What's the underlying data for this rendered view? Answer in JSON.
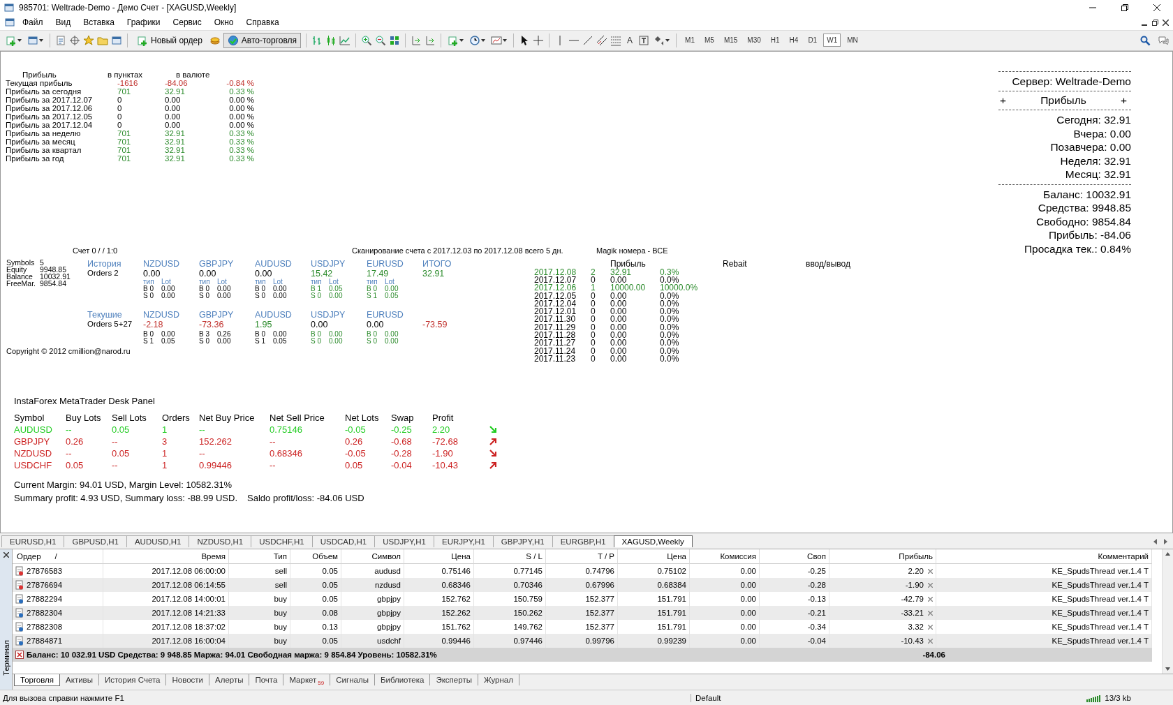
{
  "window": {
    "title": "985701: Weltrade-Demo - Демо Счет - [XAGUSD,Weekly]"
  },
  "menu": [
    "Файл",
    "Вид",
    "Вставка",
    "Графики",
    "Сервис",
    "Окно",
    "Справка"
  ],
  "toolbar": {
    "new_order": "Новый ордер",
    "autotrading": "Авто-торговля",
    "text_tool": "A",
    "timeframes": [
      {
        "label": "M1",
        "selected": false
      },
      {
        "label": "M5",
        "selected": false
      },
      {
        "label": "M15",
        "selected": false
      },
      {
        "label": "M30",
        "selected": false
      },
      {
        "label": "H1",
        "selected": false
      },
      {
        "label": "H4",
        "selected": false
      },
      {
        "label": "D1",
        "selected": false
      },
      {
        "label": "W1",
        "selected": true
      },
      {
        "label": "MN",
        "selected": false
      }
    ]
  },
  "profit_table": {
    "headers": [
      "Прибыль",
      "в пунктах",
      "в валюте"
    ],
    "rows": [
      {
        "label": "Текущая прибыль",
        "points": "-1616",
        "money": "-84.06",
        "percent": "-0.84 %",
        "kind": "loss"
      },
      {
        "label": "Прибыль за сегодня",
        "points": "701",
        "money": "32.91",
        "percent": "0.33 %",
        "kind": "gain"
      },
      {
        "label": "Прибыль за 2017.12.07",
        "points": "0",
        "money": "0.00",
        "percent": "0.00 %",
        "kind": "neutral"
      },
      {
        "label": "Прибыль за 2017.12.06",
        "points": "0",
        "money": "0.00",
        "percent": "0.00 %",
        "kind": "neutral"
      },
      {
        "label": "Прибыль за 2017.12.05",
        "points": "0",
        "money": "0.00",
        "percent": "0.00 %",
        "kind": "neutral"
      },
      {
        "label": "Прибыль за 2017.12.04",
        "points": "0",
        "money": "0.00",
        "percent": "0.00 %",
        "kind": "neutral"
      },
      {
        "label": "Прибыль за неделю",
        "points": "701",
        "money": "32.91",
        "percent": "0.33 %",
        "kind": "gain"
      },
      {
        "label": "Прибыль за месяц",
        "points": "701",
        "money": "32.91",
        "percent": "0.33 %",
        "kind": "gain"
      },
      {
        "label": "Прибыль за квартал",
        "points": "701",
        "money": "32.91",
        "percent": "0.33 %",
        "kind": "gain"
      },
      {
        "label": "Прибыль за год",
        "points": "701",
        "money": "32.91",
        "percent": "0.33 %",
        "kind": "gain"
      }
    ]
  },
  "server_panel": {
    "server": "Сервер: Weltrade-Demo",
    "header": {
      "left": "+",
      "title": "Прибыль",
      "right": "+"
    },
    "profits": [
      "Сегодня: 32.91",
      "Вчера: 0.00",
      "Позавчера: 0.00",
      "Неделя: 32.91",
      "Месяц: 32.91"
    ],
    "account": [
      "Баланс: 10032.91",
      "Средства: 9948.85",
      "Свободно: 9854.84",
      "Прибыль:   -84.06",
      "Просадка тек.:  0.84%"
    ]
  },
  "scanner": {
    "account_line": "Счет 0 /  / 1:0",
    "scan_line": "Сканирование счета с 2017.12.03 по 2017.12.08 всего 5 дн.",
    "magic_line": "Magik номера - ВСЕ",
    "stats": [
      {
        "label": "Symbols",
        "value": "5"
      },
      {
        "label": "Equity",
        "value": "9948.85"
      },
      {
        "label": "Balance",
        "value": "10032.91"
      },
      {
        "label": "FreeMar.",
        "value": "9854.84"
      }
    ],
    "sections": [
      {
        "title": "История",
        "orders": "Orders 2",
        "total_label": "ИТОГО",
        "total": {
          "text": "32.91",
          "color": "#2a8a2a"
        },
        "symbols": [
          {
            "name": "NZDUSD",
            "value": {
              "text": "0.00",
              "color": "#000000"
            },
            "type_label": "тип",
            "lot_label": "Lot",
            "lots": {
              "buy": "B 0",
              "buy_lot": "0.00",
              "sell": "S 0",
              "sell_lot": "0.00",
              "color": "#000000"
            }
          },
          {
            "name": "GBPJPY",
            "value": {
              "text": "0.00",
              "color": "#000000"
            },
            "type_label": "тип",
            "lot_label": "Lot",
            "lots": {
              "buy": "B 0",
              "buy_lot": "0.00",
              "sell": "S 0",
              "sell_lot": "0.00",
              "color": "#000000"
            }
          },
          {
            "name": "AUDUSD",
            "value": {
              "text": "0.00",
              "color": "#000000"
            },
            "type_label": "тип",
            "lot_label": "Lot",
            "lots": {
              "buy": "B 0",
              "buy_lot": "0.00",
              "sell": "S 0",
              "sell_lot": "0.00",
              "color": "#000000"
            }
          },
          {
            "name": "USDJPY",
            "value": {
              "text": "15.42",
              "color": "#2a8a2a"
            },
            "type_label": "тип",
            "lot_label": "Lot",
            "lots": {
              "buy": "B 1",
              "buy_lot": "0.05",
              "sell": "S 0",
              "sell_lot": "0.00",
              "color": "#2a8a2a"
            }
          },
          {
            "name": "EURUSD",
            "value": {
              "text": "17.49",
              "color": "#2a8a2a"
            },
            "type_label": "тип",
            "lot_label": "Lot",
            "lots": {
              "buy": "B 0",
              "buy_lot": "0.00",
              "sell": "S 1",
              "sell_lot": "0.05",
              "color": "#2a8a2a"
            }
          }
        ]
      },
      {
        "title": "Текушие",
        "orders": "Orders 5+27",
        "total": {
          "text": "-73.59",
          "color": "#c0302c"
        },
        "symbols": [
          {
            "name": "NZDUSD",
            "value": {
              "text": "-2.18",
              "color": "#c0302c"
            },
            "lots": {
              "buy": "B 0",
              "buy_lot": "0.00",
              "sell": "S 1",
              "sell_lot": "0.05",
              "color": "#000000"
            }
          },
          {
            "name": "GBPJPY",
            "value": {
              "text": "-73.36",
              "color": "#c0302c"
            },
            "lots": {
              "buy": "B 3",
              "buy_lot": "0.26",
              "sell": "S 0",
              "sell_lot": "0.00",
              "color": "#000000"
            }
          },
          {
            "name": "AUDUSD",
            "value": {
              "text": "1.95",
              "color": "#2a8a2a"
            },
            "lots": {
              "buy": "B 0",
              "buy_lot": "0.00",
              "sell": "S 1",
              "sell_lot": "0.05",
              "color": "#000000"
            }
          },
          {
            "name": "USDJPY",
            "value": {
              "text": "0.00",
              "color": "#000000"
            },
            "lots": {
              "buy": "B 0",
              "buy_lot": "0.00",
              "sell": "S 0",
              "sell_lot": "0.00",
              "color": "#2a8a2a"
            }
          },
          {
            "name": "EURUSD",
            "value": {
              "text": "0.00",
              "color": "#000000"
            },
            "lots": {
              "buy": "B 0",
              "buy_lot": "0.00",
              "sell": "S 0",
              "sell_lot": "0.00",
              "color": "#2a8a2a"
            }
          }
        ]
      }
    ],
    "copyright": "Copyright © 2012 cmillion@narod.ru",
    "daily_headers": [
      "Прибыль",
      "Rebait",
      "ввод/вывод"
    ],
    "daily": [
      {
        "date": "2017.12.08",
        "count": "2",
        "profit": "32.91",
        "percent": "0.3%",
        "color": "#2a8a2a"
      },
      {
        "date": "2017.12.07",
        "count": "0",
        "profit": "0.00",
        "percent": "0.0%",
        "color": "#000000"
      },
      {
        "date": "2017.12.06",
        "count": "1",
        "profit": "10000.00",
        "percent": "10000.0%",
        "color": "#2a8a2a"
      },
      {
        "date": "2017.12.05",
        "count": "0",
        "profit": "0.00",
        "percent": "0.0%",
        "color": "#000000"
      },
      {
        "date": "2017.12.04",
        "count": "0",
        "profit": "0.00",
        "percent": "0.0%",
        "color": "#000000"
      },
      {
        "date": "2017.12.01",
        "count": "0",
        "profit": "0.00",
        "percent": "0.0%",
        "color": "#000000"
      },
      {
        "date": "2017.11.30",
        "count": "0",
        "profit": "0.00",
        "percent": "0.0%",
        "color": "#000000"
      },
      {
        "date": "2017.11.29",
        "count": "0",
        "profit": "0.00",
        "percent": "0.0%",
        "color": "#000000"
      },
      {
        "date": "2017.11.28",
        "count": "0",
        "profit": "0.00",
        "percent": "0.0%",
        "color": "#000000"
      },
      {
        "date": "2017.11.27",
        "count": "0",
        "profit": "0.00",
        "percent": "0.0%",
        "color": "#000000"
      },
      {
        "date": "2017.11.24",
        "count": "0",
        "profit": "0.00",
        "percent": "0.0%",
        "color": "#000000"
      },
      {
        "date": "2017.11.23",
        "count": "0",
        "profit": "0.00",
        "percent": "0.0%",
        "color": "#000000"
      }
    ]
  },
  "desk_panel": {
    "title": "InstaForex MetaTrader Desk Panel",
    "columns": [
      "Symbol",
      "Buy Lots",
      "Sell Lots",
      "Orders",
      "Net Buy Price",
      "Net Sell Price",
      "Net Lots",
      "Swap",
      "Profit"
    ],
    "rows": [
      {
        "cells": [
          "AUDUSD",
          "--",
          "0.05",
          "1",
          "--",
          "0.75146",
          "-0.05",
          "-0.25",
          "2.20"
        ],
        "color": "#22cc22",
        "kind": "down"
      },
      {
        "cells": [
          "GBPJPY",
          "0.26",
          "--",
          "3",
          "152.262",
          "--",
          "0.26",
          "-0.68",
          "-72.68"
        ],
        "color": "#cc2222",
        "kind": "up"
      },
      {
        "cells": [
          "NZDUSD",
          "--",
          "0.05",
          "1",
          "--",
          "0.68346",
          "-0.05",
          "-0.28",
          "-1.90"
        ],
        "color": "#cc2222",
        "kind": "down"
      },
      {
        "cells": [
          "USDCHF",
          "0.05",
          "--",
          "1",
          "0.99446",
          "--",
          "0.05",
          "-0.04",
          "-10.43"
        ],
        "color": "#cc2222",
        "kind": "up"
      }
    ],
    "margin_line": "Current Margin: 94.01 USD, Margin Level: 10582.31%",
    "summary_line": "Summary profit: 4.93 USD, Summary loss: -88.99 USD.",
    "saldo": "Saldo profit/loss: -84.06 USD"
  },
  "chart_tabs": [
    {
      "label": "EURUSD,H1",
      "selected": false
    },
    {
      "label": "GBPUSD,H1",
      "selected": false
    },
    {
      "label": "AUDUSD,H1",
      "selected": false
    },
    {
      "label": "NZDUSD,H1",
      "selected": false
    },
    {
      "label": "USDCHF,H1",
      "selected": false
    },
    {
      "label": "USDCAD,H1",
      "selected": false
    },
    {
      "label": "USDJPY,H1",
      "selected": false
    },
    {
      "label": "EURJPY,H1",
      "selected": false
    },
    {
      "label": "GBPJPY,H1",
      "selected": false
    },
    {
      "label": "EURGBP,H1",
      "selected": false
    },
    {
      "label": "XAGUSD,Weekly",
      "selected": true
    }
  ],
  "terminal": {
    "side_label": "Терминал",
    "sort_mark": "/",
    "columns": [
      "Ордер",
      "Время",
      "Тип",
      "Объем",
      "Символ",
      "Цена",
      "S / L",
      "T / P",
      "Цена",
      "Комиссия",
      "Своп",
      "Прибыль",
      "Комментарий"
    ],
    "rows": [
      {
        "kind": "sell",
        "cells": [
          "27876583",
          "2017.12.08 06:00:00",
          "sell",
          "0.05",
          "audusd",
          "0.75146",
          "0.77145",
          "0.74796",
          "0.75102",
          "0.00",
          "-0.25",
          "2.20",
          "KE_SpudsThread ver.1.4 T"
        ]
      },
      {
        "kind": "sell",
        "cells": [
          "27876694",
          "2017.12.08 06:14:55",
          "sell",
          "0.05",
          "nzdusd",
          "0.68346",
          "0.70346",
          "0.67996",
          "0.68384",
          "0.00",
          "-0.28",
          "-1.90",
          "KE_SpudsThread ver.1.4 T"
        ]
      },
      {
        "kind": "buy",
        "cells": [
          "27882294",
          "2017.12.08 14:00:01",
          "buy",
          "0.05",
          "gbpjpy",
          "152.762",
          "150.759",
          "152.377",
          "151.791",
          "0.00",
          "-0.13",
          "-42.79",
          "KE_SpudsThread ver.1.4 T"
        ]
      },
      {
        "kind": "buy",
        "cells": [
          "27882304",
          "2017.12.08 14:21:33",
          "buy",
          "0.08",
          "gbpjpy",
          "152.262",
          "150.262",
          "152.377",
          "151.791",
          "0.00",
          "-0.21",
          "-33.21",
          "KE_SpudsThread ver.1.4 T"
        ]
      },
      {
        "kind": "buy",
        "cells": [
          "27882308",
          "2017.12.08 18:37:02",
          "buy",
          "0.13",
          "gbpjpy",
          "151.762",
          "149.762",
          "152.377",
          "151.791",
          "0.00",
          "-0.34",
          "3.32",
          "KE_SpudsThread ver.1.4 T"
        ]
      },
      {
        "kind": "buy",
        "cells": [
          "27884871",
          "2017.12.08 16:00:04",
          "buy",
          "0.05",
          "usdchf",
          "0.99446",
          "0.97446",
          "0.99796",
          "0.99239",
          "0.00",
          "-0.04",
          "-10.43",
          "KE_SpudsThread ver.1.4 T"
        ]
      }
    ],
    "summary": {
      "text": "Баланс: 10 032.91 USD  Средства: 9 948.85  Маржа: 94.01  Свободная маржа: 9 854.84  Уровень: 10582.31%",
      "profit": "-84.06"
    },
    "tabs": [
      {
        "label": "Торговля",
        "selected": true
      },
      {
        "label": "Активы",
        "selected": false
      },
      {
        "label": "История Счета",
        "selected": false
      },
      {
        "label": "Новости",
        "selected": false
      },
      {
        "label": "Алерты",
        "selected": false
      },
      {
        "label": "Почта",
        "selected": false
      },
      {
        "label": "Маркет",
        "badge": "59",
        "selected": false
      },
      {
        "label": "Сигналы",
        "selected": false
      },
      {
        "label": "Библиотека",
        "selected": false
      },
      {
        "label": "Эксперты",
        "selected": false
      },
      {
        "label": "Журнал",
        "selected": false
      }
    ]
  },
  "status_bar": {
    "help": "Для вызова справки нажмите F1",
    "profile": "Default",
    "traffic": "13/3 kb"
  }
}
